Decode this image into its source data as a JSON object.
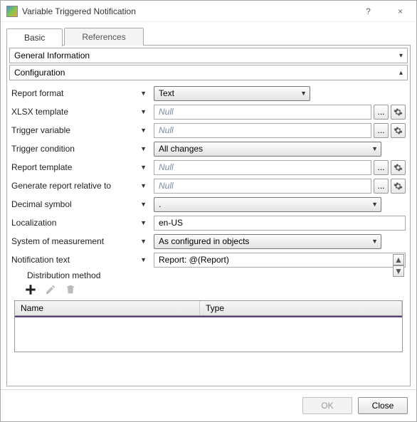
{
  "title": "Variable Triggered Notification",
  "tabs": {
    "basic": "Basic",
    "references": "References"
  },
  "sections": {
    "general": {
      "title": "General Information",
      "expanded": false
    },
    "config": {
      "title": "Configuration",
      "expanded": true
    }
  },
  "fields": {
    "report_format": {
      "label": "Report format",
      "value": "Text"
    },
    "xlsx_template": {
      "label": "XLSX template",
      "value": "Null"
    },
    "trigger_variable": {
      "label": "Trigger variable",
      "value": "Null"
    },
    "trigger_condition": {
      "label": "Trigger condition",
      "value": "All changes"
    },
    "report_template": {
      "label": "Report template",
      "value": "Null"
    },
    "gen_relative": {
      "label": "Generate report relative to",
      "value": "Null"
    },
    "decimal_symbol": {
      "label": "Decimal symbol",
      "value": "."
    },
    "localization": {
      "label": "Localization",
      "value": "en-US"
    },
    "system_measure": {
      "label": "System of measurement",
      "value": "As configured in objects"
    },
    "notification_text": {
      "label": "Notification text",
      "value": "Report: @(Report)"
    }
  },
  "distribution": {
    "label": "Distribution method",
    "columns": {
      "name": "Name",
      "type": "Type"
    },
    "rows": []
  },
  "buttons": {
    "ok": "OK",
    "close": "Close",
    "browse": "...",
    "help": "?"
  },
  "icons": {
    "gear": "gear",
    "plus": "plus",
    "pencil": "pencil",
    "trash": "trash",
    "close_x": "×",
    "caret_down": "▾",
    "caret_up": "▴",
    "tri_down": "▼",
    "tri_up": "▲",
    "small_tri": "▾"
  }
}
